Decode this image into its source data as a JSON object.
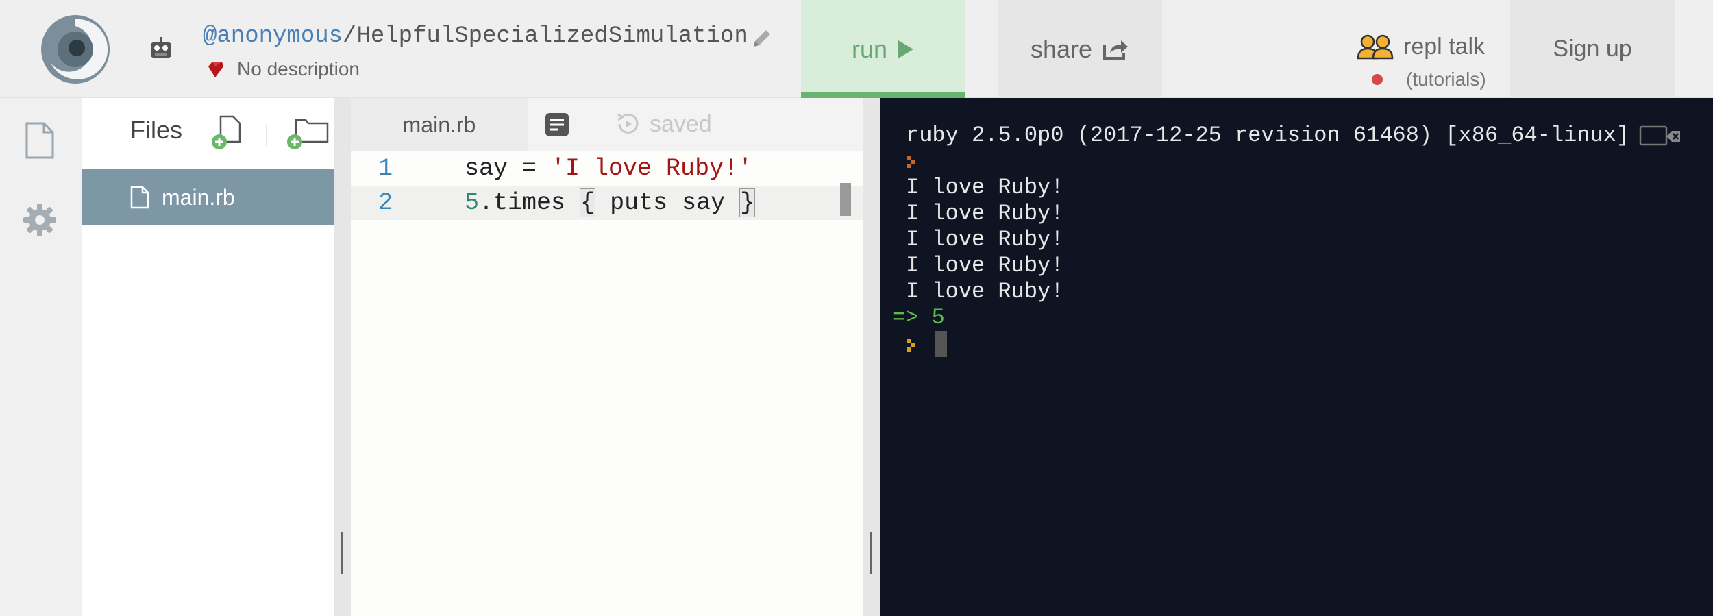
{
  "header": {
    "owner": "@anonymous",
    "separator": "/",
    "repl_name": "HelpfulSpecializedSimulation",
    "description": "No description",
    "run_label": "run",
    "share_label": "share",
    "talk_label": "repl talk",
    "talk_sub": "(tutorials)",
    "signup_label": "Sign up"
  },
  "files": {
    "title": "Files",
    "items": [
      {
        "label": "main.rb"
      }
    ]
  },
  "editor": {
    "tab": "main.rb",
    "status": "saved",
    "lines": [
      {
        "n": "1",
        "p1": "say = ",
        "p2": "'I love Ruby!'"
      },
      {
        "n": "2",
        "p1": "5",
        "p2": ".times ",
        "p3": "{",
        "p4": " puts say ",
        "p5": "}"
      }
    ]
  },
  "console": {
    "header": "ruby 2.5.0p0 (2017-12-25 revision 61468) [x86_64-linux]",
    "output": [
      "I love Ruby!",
      "I love Ruby!",
      "I love Ruby!",
      "I love Ruby!",
      "I love Ruby!"
    ],
    "return": "=> 5"
  },
  "colors": {
    "accent_run": "#69b56f",
    "file_selected": "#7e97a6",
    "console_bg": "#0e1422",
    "string": "#a31515"
  },
  "icons": [
    "replit-logo",
    "user-avatar",
    "pencil-icon",
    "ruby-gem-icon",
    "play-icon",
    "share-icon",
    "people-icon",
    "file-icon",
    "gear-icon",
    "add-file-icon",
    "add-folder-icon",
    "format-icon",
    "saved-history-icon",
    "clear-console-icon"
  ]
}
